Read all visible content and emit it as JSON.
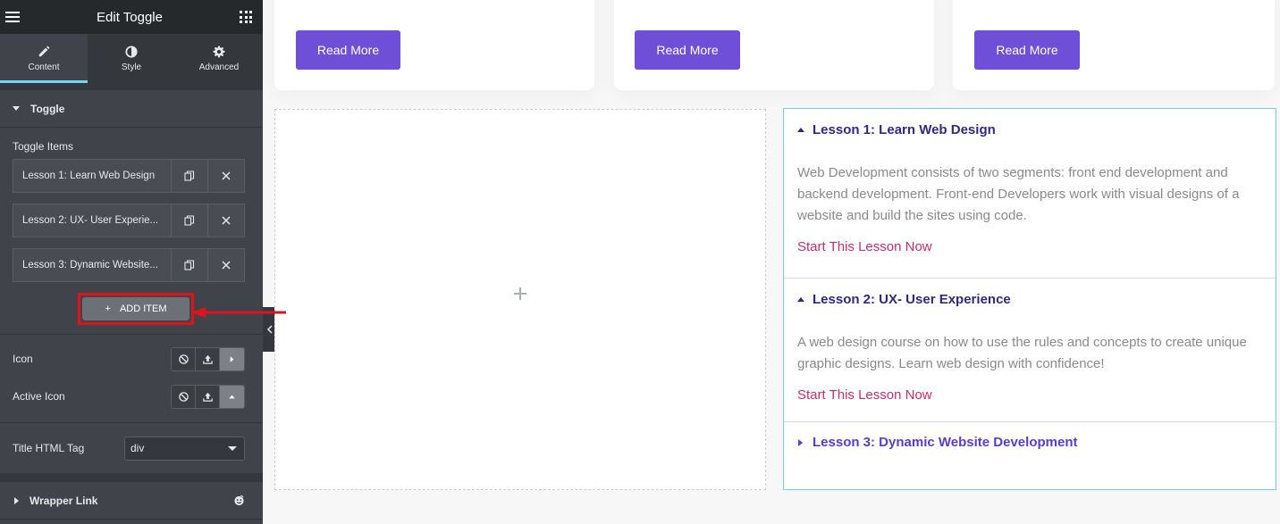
{
  "sidebar": {
    "title": "Edit Toggle",
    "tabs": [
      {
        "label": "Content",
        "icon": "pencil-icon",
        "active": true
      },
      {
        "label": "Style",
        "icon": "half-circle-icon",
        "active": false
      },
      {
        "label": "Advanced",
        "icon": "gear-icon",
        "active": false
      }
    ],
    "toggle_section": {
      "label": "Toggle",
      "items_label": "Toggle Items",
      "items": [
        {
          "title": "Lesson 1: Learn Web Design"
        },
        {
          "title": "Lesson 2: UX- User Experie..."
        },
        {
          "title": "Lesson 3: Dynamic Website..."
        }
      ],
      "add_item_label": "ADD ITEM",
      "icon_label": "Icon",
      "active_icon_label": "Active Icon",
      "title_tag_label": "Title HTML Tag",
      "title_tag_value": "div"
    },
    "wrapper_link_label": "Wrapper Link"
  },
  "canvas": {
    "cards": [
      {
        "button_label": "Read More"
      },
      {
        "button_label": "Read More"
      },
      {
        "button_label": "Read More"
      }
    ],
    "accordion": {
      "items": [
        {
          "title": "Lesson 1: Learn Web Design",
          "open": true,
          "body": "Web Development consists of two segments: front end development and backend development. Front-end Developers work with visual designs of a website and build the sites using code.",
          "link": "Start This Lesson Now"
        },
        {
          "title": "Lesson 2: UX- User Experience",
          "open": true,
          "body": "A web design course on how to use the rules and concepts to create unique graphic designs. Learn web design with confidence!",
          "link": "Start This Lesson Now"
        },
        {
          "title": "Lesson 3: Dynamic Website Development",
          "open": false
        }
      ]
    }
  },
  "colors": {
    "accent_tab": "#71d7f7",
    "button_purple": "#6f4fd8",
    "title_dark": "#2e2a84",
    "title_closed": "#5a3cd0",
    "link_pink": "#d02a6a",
    "annotation_red": "#e0131a"
  }
}
